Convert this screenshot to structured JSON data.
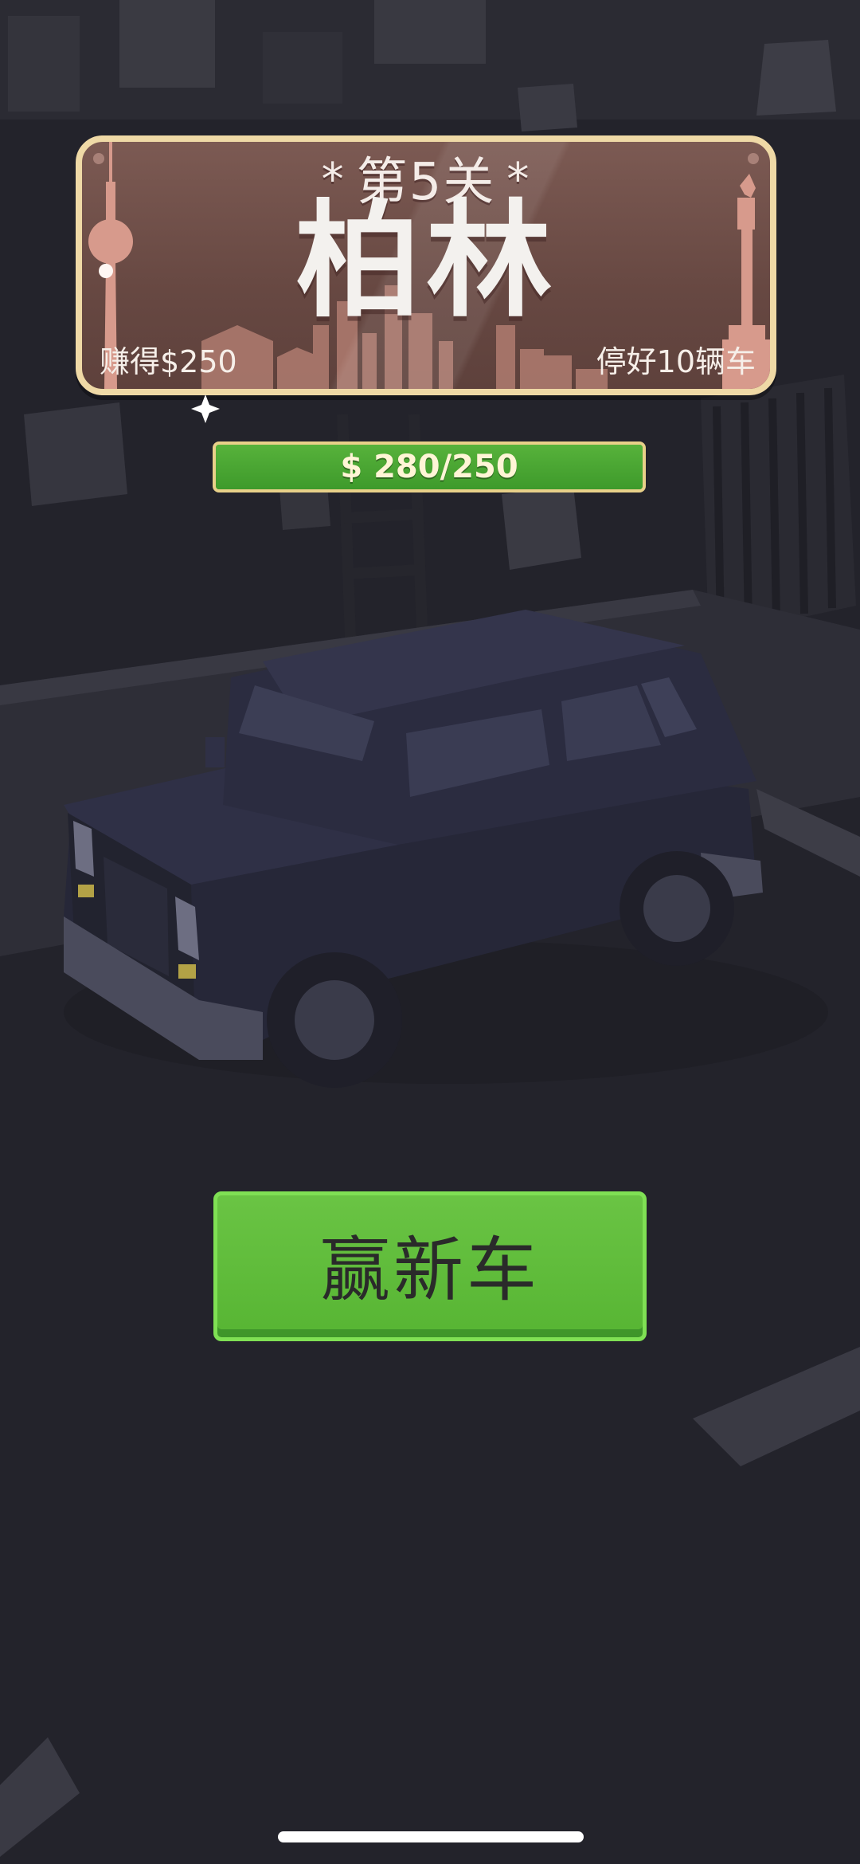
{
  "level": {
    "label": "第5关",
    "decoration": "*",
    "city": "柏林",
    "reward": "赚得$250",
    "goal": "停好10辆车"
  },
  "progress": {
    "text": "$ 280/250",
    "current": 280,
    "target": 250,
    "fraction": 1.0
  },
  "action": {
    "label": "赢新车"
  },
  "colors": {
    "background": "#23232b",
    "banner": "#6f4f49",
    "banner_border": "#efd9a6",
    "progress_fill": "#4aa832",
    "button": "#5fbd3b",
    "button_border": "#7fe054",
    "car": "#2c2c3e"
  },
  "icons": {
    "tower_left": "tv-tower-icon",
    "column_right": "victory-column-icon",
    "sparkle": "sparkle-icon"
  }
}
